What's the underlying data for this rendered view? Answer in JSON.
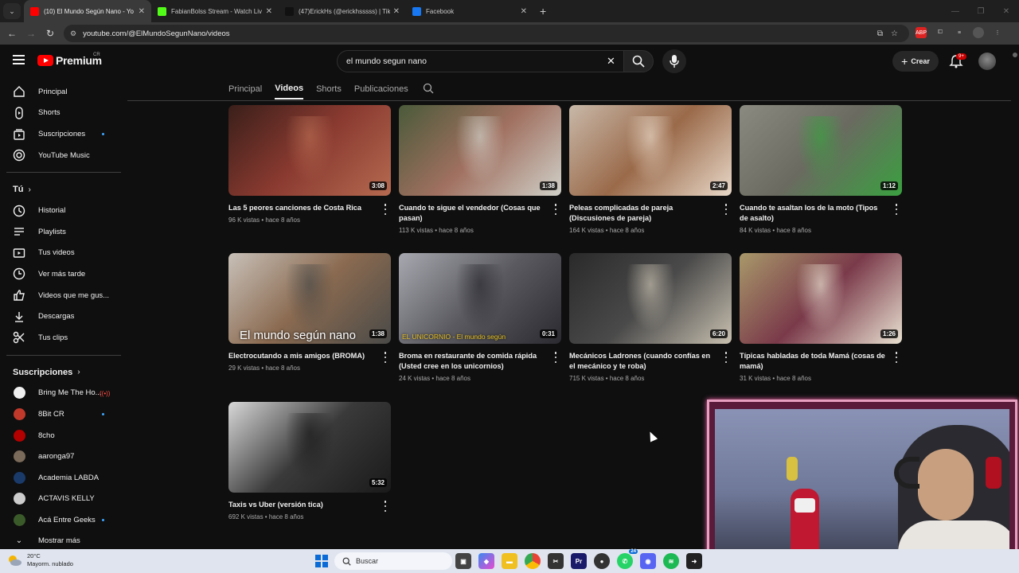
{
  "browser": {
    "tabs": [
      {
        "title": "(10) El Mundo Según Nano - Yo",
        "icon_color": "#ff0000",
        "active": true
      },
      {
        "title": "FabianBolss Stream - Watch Liv",
        "icon_color": "#53fc18",
        "active": false
      },
      {
        "title": "(47)ErickHs (@erickhsssss) | Tik",
        "icon_color": "#111111",
        "active": false
      },
      {
        "title": "Facebook",
        "icon_color": "#1877f2",
        "active": false
      }
    ],
    "url": "youtube.com/@ElMundoSegunNano/videos"
  },
  "header": {
    "logo_text": "Premium",
    "country_code": "CR",
    "search_value": "el mundo segun nano",
    "create_label": "Crear",
    "notif_count": "9+"
  },
  "sidebar": {
    "main": [
      {
        "label": "Principal",
        "icon": "home-icon"
      },
      {
        "label": "Shorts",
        "icon": "shorts-icon"
      },
      {
        "label": "Suscripciones",
        "icon": "subscriptions-icon",
        "dot": true
      },
      {
        "label": "YouTube Music",
        "icon": "music-icon"
      }
    ],
    "you_heading": "Tú",
    "you": [
      {
        "label": "Historial",
        "icon": "history-icon"
      },
      {
        "label": "Playlists",
        "icon": "playlists-icon"
      },
      {
        "label": "Tus videos",
        "icon": "your-videos-icon"
      },
      {
        "label": "Ver más tarde",
        "icon": "watch-later-icon"
      },
      {
        "label": "Videos que me gus...",
        "icon": "like-icon"
      },
      {
        "label": "Descargas",
        "icon": "download-icon"
      },
      {
        "label": "Tus clips",
        "icon": "clips-icon"
      }
    ],
    "subs_heading": "Suscripciones",
    "subs": [
      {
        "label": "Bring Me The Ho...",
        "color": "#f0f0f0",
        "live": true
      },
      {
        "label": "8Bit CR",
        "color": "#c0392b",
        "dot": true
      },
      {
        "label": "8cho",
        "color": "#b30000"
      },
      {
        "label": "aaronga97",
        "color": "#7a6a5a"
      },
      {
        "label": "Academia LABDA",
        "color": "#1a3a6a"
      },
      {
        "label": "ACTAVIS KELLY",
        "color": "#cccccc"
      },
      {
        "label": "Acá Entre Geeks",
        "color": "#3a5a2a",
        "dot": true
      },
      {
        "label": "Mostrar más",
        "color": null
      }
    ]
  },
  "channel_tabs": [
    "Principal",
    "Videos",
    "Shorts",
    "Publicaciones"
  ],
  "videos": [
    {
      "title": "Las 5 peores canciones de Costa Rica",
      "meta": "96 K vistas • hace 8 años",
      "duration": "3:08",
      "thumb": [
        "#3a1f1a",
        "#8a3a30",
        "#b56a50"
      ]
    },
    {
      "title": "Cuando te sigue el vendedor (Cosas que pasan)",
      "meta": "113 K vistas • hace 8 años",
      "duration": "1:38",
      "thumb": [
        "#4a5a3a",
        "#a07060",
        "#d0d0c8"
      ]
    },
    {
      "title": "Peleas complicadas de pareja (Discusiones de pareja)",
      "meta": "164 K vistas • hace 8 años",
      "duration": "2:47",
      "thumb": [
        "#c8b8a8",
        "#9a6a4a",
        "#e8d8c8"
      ]
    },
    {
      "title": "Cuando te asaltan los de la moto (Tipos de asalto)",
      "meta": "84 K vistas • hace 8 años",
      "duration": "1:12",
      "thumb": [
        "#8a8a80",
        "#6a6a60",
        "#3aa040"
      ]
    },
    {
      "title": "Electrocutando a mis amigos (BROMA)",
      "meta": "29 K vistas • hace 8 años",
      "duration": "1:38",
      "thumb": [
        "#c8c0b8",
        "#8a6a50",
        "#4a4a48"
      ],
      "overlay": "El mundo según nano"
    },
    {
      "title": "Broma en restaurante de comida rápida (Usted cree en los unicornios)",
      "meta": "24 K vistas • hace 8 años",
      "duration": "0:31",
      "thumb": [
        "#a8a8b0",
        "#5a5a60",
        "#2a2a30"
      ],
      "overlay": "EL UNICORNIO - El mundo según"
    },
    {
      "title": "Mecánicos Ladrones (cuando confías en el mecánico y te roba)",
      "meta": "715 K vistas • hace 8 años",
      "duration": "6:20",
      "thumb": [
        "#2a2a2a",
        "#4a4a4a",
        "#c8c0b0"
      ]
    },
    {
      "title": "Típicas habladas de toda Mamá (cosas de mamá)",
      "meta": "31 K vistas • hace 8 años",
      "duration": "1:26",
      "thumb": [
        "#a8986a",
        "#7a3a4a",
        "#e8e0d0"
      ]
    },
    {
      "title": "Taxis vs Uber (versión tica)",
      "meta": "692 K vistas • hace 8 años",
      "duration": "5:32",
      "thumb": [
        "#d8d8d8",
        "#3a3a3a",
        "#1a1a1a"
      ]
    }
  ],
  "taskbar": {
    "temperature": "20°C",
    "weather_desc": "Mayorm. nublado",
    "search_placeholder": "Buscar",
    "badge_count": "24"
  }
}
